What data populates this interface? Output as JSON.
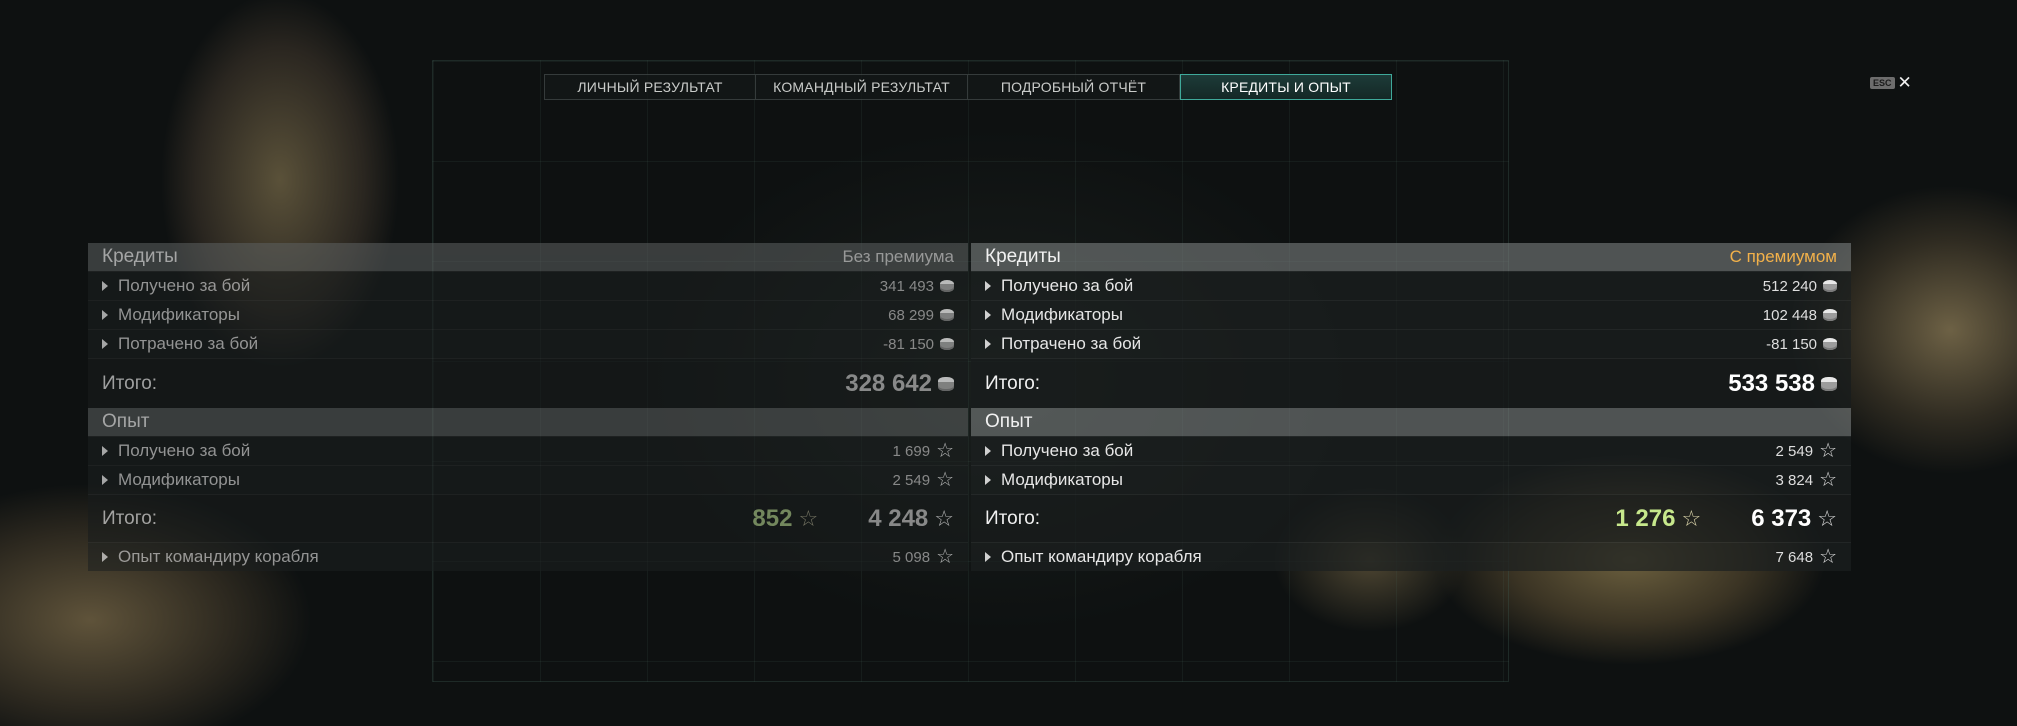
{
  "tabs": [
    {
      "label": "ЛИЧНЫЙ РЕЗУЛЬТАТ",
      "active": false
    },
    {
      "label": "КОМАНДНЫЙ РЕЗУЛЬТАТ",
      "active": false
    },
    {
      "label": "ПОДРОБНЫЙ ОТЧЁТ",
      "active": false
    },
    {
      "label": "КРЕДИТЫ И ОПЫТ",
      "active": true
    }
  ],
  "close": {
    "key_label": "ESC",
    "icon": "close-icon"
  },
  "colors": {
    "premium_label": "#f2b14a",
    "free_xp": "#c7e88c",
    "active_tab_border": "#3fa99a"
  },
  "left": {
    "credits": {
      "title": "Кредиты",
      "premium_label": "Без премиума",
      "rows": [
        {
          "label": "Получено за бой",
          "value": "341 493"
        },
        {
          "label": "Модификаторы",
          "value": "68 299"
        },
        {
          "label": "Потрачено за бой",
          "value": "-81 150"
        }
      ],
      "total_label": "Итого:",
      "total_value": "328 642"
    },
    "xp": {
      "title": "Опыт",
      "rows": [
        {
          "label": "Получено за бой",
          "value": "1 699"
        },
        {
          "label": "Модификаторы",
          "value": "2 549"
        }
      ],
      "total_label": "Итого:",
      "free_xp": "852",
      "total_value": "4 248",
      "commander": {
        "label": "Опыт командиру корабля",
        "value": "5 098"
      }
    }
  },
  "right": {
    "credits": {
      "title": "Кредиты",
      "premium_label": "С премиумом",
      "rows": [
        {
          "label": "Получено за бой",
          "value": "512 240"
        },
        {
          "label": "Модификаторы",
          "value": "102 448"
        },
        {
          "label": "Потрачено за бой",
          "value": "-81 150"
        }
      ],
      "total_label": "Итого:",
      "total_value": "533 538"
    },
    "xp": {
      "title": "Опыт",
      "rows": [
        {
          "label": "Получено за бой",
          "value": "2 549"
        },
        {
          "label": "Модификаторы",
          "value": "3 824"
        }
      ],
      "total_label": "Итого:",
      "free_xp": "1 276",
      "total_value": "6 373",
      "commander": {
        "label": "Опыт командиру корабля",
        "value": "7 648"
      }
    }
  }
}
